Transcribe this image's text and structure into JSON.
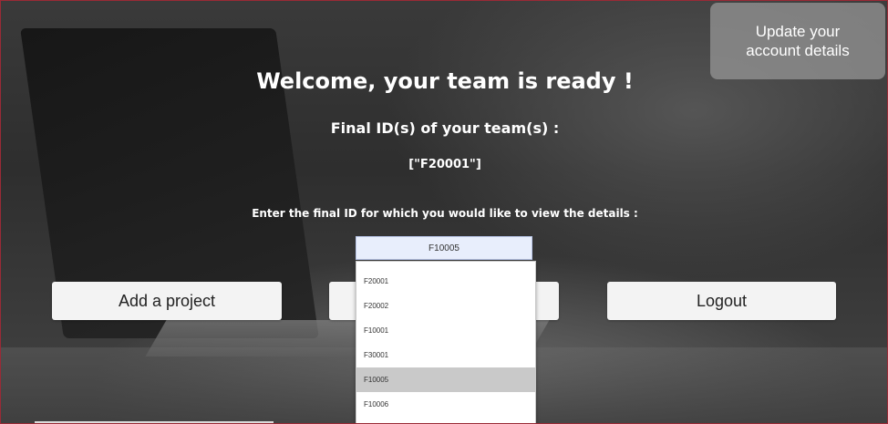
{
  "header": {
    "update_button": "Update your\naccount details"
  },
  "main": {
    "title": "Welcome, your team is ready !",
    "subtitle": "Final ID(s) of your team(s) :",
    "team_ids": "[\"F20001\"]",
    "prompt": "Enter the final ID for which you would like to view the details :",
    "id_input_value": "F10005"
  },
  "actions": {
    "add_project": "Add a project",
    "middle": "",
    "logout": "Logout"
  },
  "dropdown": {
    "options": [
      "F20001",
      "F20002",
      "F10001",
      "F30001",
      "F10005",
      "F10006"
    ],
    "highlighted": "F10005"
  },
  "colors": {
    "frame_border": "#9a2a36",
    "input_bg": "#e8eefc",
    "highlight": "#c9c9c9"
  }
}
